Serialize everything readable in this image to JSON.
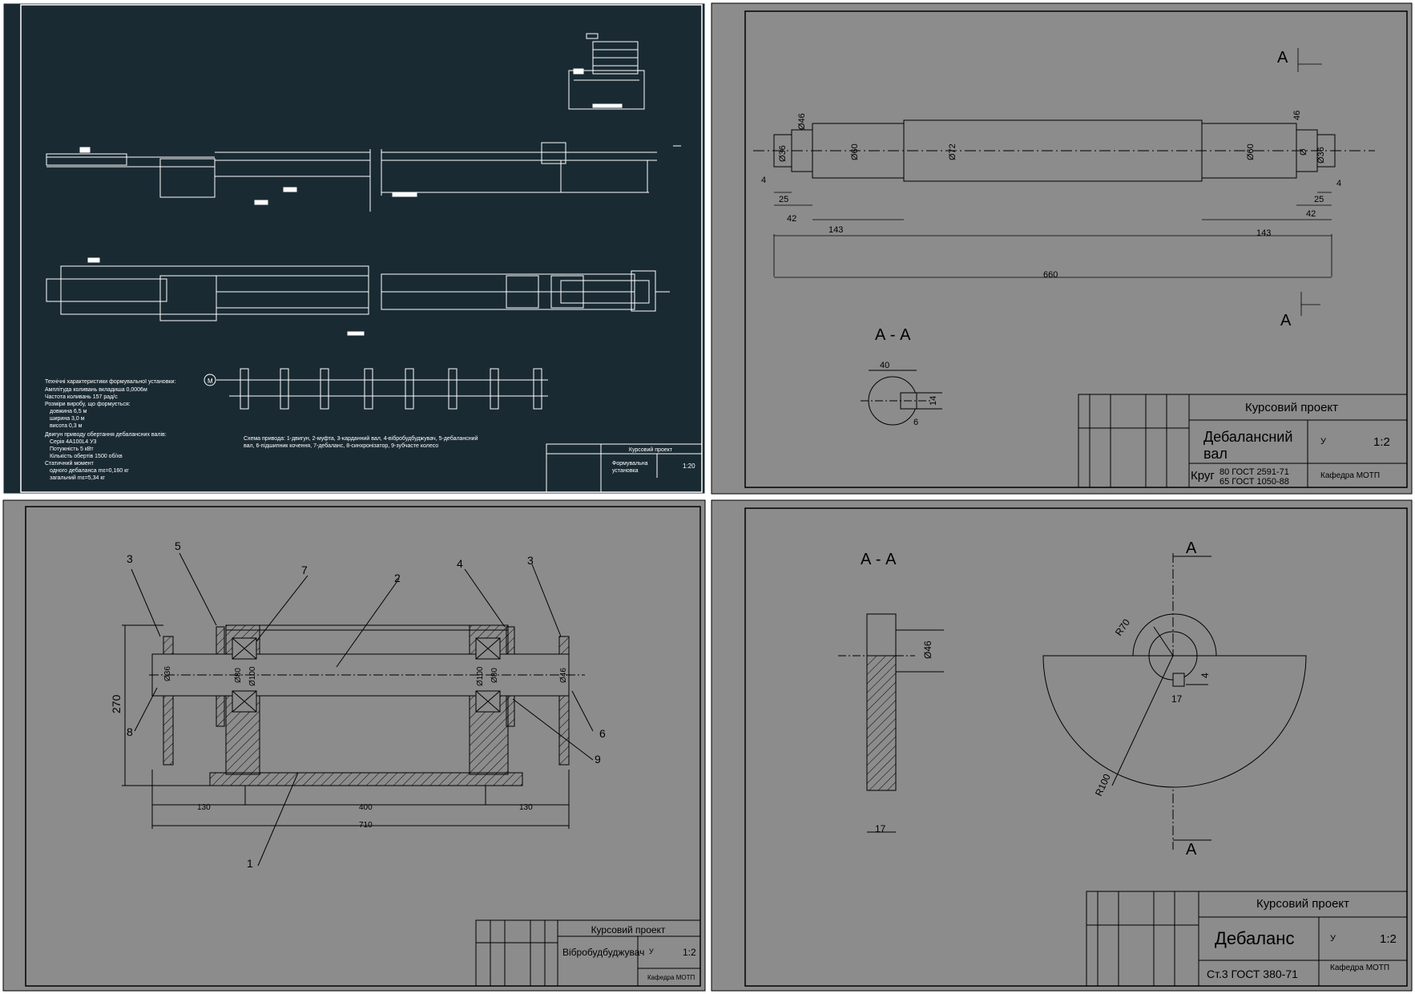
{
  "sheet1": {
    "spec_title": "Технічні характеристики формувальної установки:",
    "spec_lines": [
      "Амплітуда коливань вкладиша 0,0006м",
      "Частота коливань 157 рад/с",
      "Розміри виробу, що формується:",
      "   довжина 6,5 м",
      "   ширина 3,0 м",
      "   висота 0,3 м",
      "Двигун приводу обертання дебалансних валів:",
      "   Серія 4А100L4 У3",
      "   Потужність 5 кВт",
      "   Кількість обертів 1500 об/хв",
      "Статичний момент",
      "   одного дебаланса mε=0,160 кг",
      "   загальний mε=5,34 кг"
    ],
    "scheme_caption_1": "Схема привода: 1-двигун, 2-муфта, 3-карданний вал, 4-вібробудбуджувач, 5-дебалансний",
    "scheme_caption_2": "вал, 6-підшипник кочення, 7-дебаланс, 8-синхронізатор, 9-зубчасте колесо",
    "title_block": {
      "project": "Курсовий проект",
      "name_1": "Формувальна",
      "name_2": "установка",
      "scale": "1:20"
    }
  },
  "sheet2": {
    "section_mark": "А",
    "dims": [
      "Ø36",
      "Ø46",
      "Ø60",
      "Ø72",
      "Ø60",
      "Ø36",
      "Ø",
      "46",
      "4",
      "25",
      "42",
      "143",
      "143",
      "25",
      "4",
      "42",
      "660"
    ],
    "section_label": "А - А",
    "section_dims": [
      "40",
      "14",
      "6"
    ],
    "title_block": {
      "project": "Курсовий проект",
      "name_1": "Дебалансний",
      "name_2": "вал",
      "scale": "1:2",
      "material_prefix": "Круг",
      "material_1": "80 ГОСТ 2591-71",
      "material_2": "65 ГОСТ 1050-88",
      "dept": "Кафедра МОТП",
      "lit": "У"
    }
  },
  "sheet3": {
    "callouts": [
      "3",
      "5",
      "7",
      "2",
      "4",
      "3",
      "8",
      "6",
      "9",
      "1"
    ],
    "dims": [
      "270",
      "Ø80",
      "Ø100",
      "Ø100",
      "Ø80",
      "Ø36",
      "Ø46",
      "130",
      "400",
      "130",
      "710"
    ],
    "title_block": {
      "project": "Курсовий проект",
      "name": "Вібробудбуджувач",
      "scale": "1:2",
      "dept": "Кафедра МОТП",
      "lit": "У"
    }
  },
  "sheet4": {
    "section_label": "А - А",
    "section_mark": "А",
    "dims": [
      "Ø46",
      "17",
      "R70",
      "R100",
      "4",
      "17"
    ],
    "title_block": {
      "project": "Курсовий проект",
      "name": "Дебаланс",
      "scale": "1:2",
      "material": "Ст.3  ГОСТ 380-71",
      "dept": "Кафедра МОТП",
      "lit": "У"
    }
  },
  "colors": {
    "sheet1_bg": "#1a2a33",
    "sheet_bg": "#8c8c8c",
    "line_dark": "#000000",
    "line_light": "#ffffff"
  }
}
